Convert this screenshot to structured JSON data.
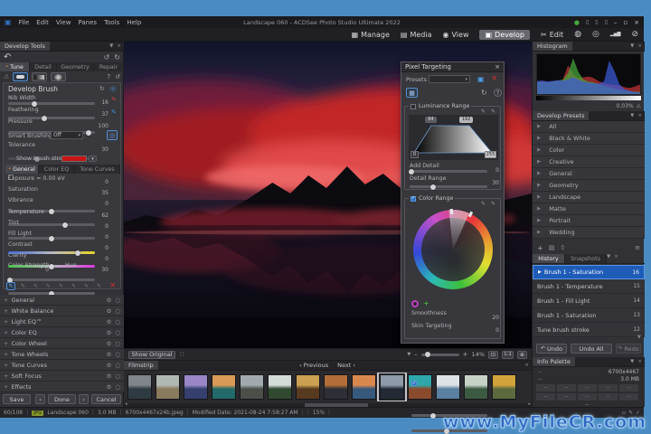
{
  "icons": {
    "app": "▣",
    "user": "●",
    "layout": "▯",
    "minimize": "–",
    "restore": "▫",
    "close": "×",
    "manage": "▦",
    "media": "▤",
    "view": "◉",
    "develop": "▣",
    "edit": "✂",
    "film": "◍",
    "c360": "◎",
    "charts": "▂▅▇",
    "privacy": "⊘",
    "pin": "▼",
    "x": "×",
    "undo": "↶",
    "redo": "↷",
    "reset": "↺",
    "refresh": "↻",
    "help": "?",
    "warn": "⚠",
    "gear": "⚙",
    "circle": "○",
    "play": "▶",
    "plus": "+",
    "menu": "≡",
    "export": "⇧",
    "grid": "▤",
    "dropper": "✎",
    "brush": "✎",
    "check": "✓",
    "target": "◎",
    "chevdown": "▾",
    "chevleft": "‹",
    "chevright": "›",
    "fit": "⊡",
    "pan": "⊕",
    "dots": "∷",
    "left": "◂",
    "right": "▸",
    "dot": "•"
  },
  "window": {
    "title": "Landscape 060 - ACDSee Photo Studio Ultimate 2022",
    "menus": [
      "File",
      "Edit",
      "View",
      "Panes",
      "Tools",
      "Help"
    ]
  },
  "modes": {
    "manage": "Manage",
    "media": "Media",
    "view": "View",
    "develop": "Develop",
    "edit": "Edit"
  },
  "left_panel": {
    "title": "Develop Tools",
    "tabs": [
      "Tune",
      "Detail",
      "Geometry",
      "Repair"
    ],
    "brush": {
      "title": "Develop Brush",
      "nib": {
        "label": "Nib Width",
        "value": "16",
        "pos": 30
      },
      "feather": {
        "label": "Feathering",
        "value": "37",
        "pos": 42
      },
      "pressure": {
        "label": "Pressure",
        "value": "100",
        "pos": 93
      },
      "smart": {
        "label": "Smart Brushing:",
        "value": "Off"
      },
      "tolerance": {
        "label": "Tolerance",
        "value": "30",
        "pos": 33
      },
      "strokes_label": "Show brush strokes",
      "tabs": [
        "General",
        "Color EQ",
        "Tone Curves"
      ],
      "sliders": [
        {
          "label": "Exposure = 0.00 eV",
          "value": "0",
          "pos": 50
        },
        {
          "label": "Saturation",
          "value": "35",
          "pos": 66
        },
        {
          "label": "Vibrance",
          "value": "0",
          "pos": 50
        },
        {
          "label": "Temperature",
          "value": "62",
          "pos": 80
        },
        {
          "label": "Tint",
          "value": "0",
          "pos": 50
        },
        {
          "label": "Fill Light",
          "value": "0",
          "pos": 2
        },
        {
          "label": "Contrast",
          "value": "0",
          "pos": 50
        },
        {
          "label": "Clarity",
          "value": "0",
          "pos": 50
        }
      ],
      "strength": {
        "label": "Color Strength",
        "value": "0",
        "pos": 8,
        "hue_label": "Hue",
        "hue_value": "30",
        "hue_pos": 50
      }
    },
    "groups": [
      "General",
      "White Balance",
      "Light EQ™",
      "Color EQ",
      "Color Wheel",
      "Tone Wheels",
      "Tone Curves",
      "Soft Focus",
      "Effects"
    ],
    "footer": {
      "save": "Save",
      "done": "Done",
      "cancel": "Cancel"
    }
  },
  "dialog": {
    "title": "Pixel Targeting",
    "presets_label": "Presets",
    "lum": {
      "label": "Luminance Range",
      "h64": "64",
      "h192": "192",
      "h0": "0",
      "h255": "255",
      "add_detail": {
        "label": "Add Detail",
        "value": "0",
        "pos": 2
      },
      "detail_range": {
        "label": "Detail Range",
        "value": "30",
        "pos": 30
      }
    },
    "color": {
      "label": "Color Range",
      "smoothness": {
        "label": "Smoothness",
        "value": "20",
        "pos": 28
      },
      "skin": {
        "label": "Skin Targeting",
        "value": "0",
        "pos": 46
      }
    }
  },
  "viewer": {
    "show_original": "Show Original",
    "zoom": "14%",
    "one_to_one": "1:1"
  },
  "filmstrip": {
    "title": "Filmstrip",
    "previous": "Previous",
    "next": "Next",
    "thumbs": [
      {
        "top": "#7f858a",
        "bottom": "#2e3b42"
      },
      {
        "top": "#b0b8b4",
        "bottom": "#8a7a5e"
      },
      {
        "top": "#9a86c6",
        "bottom": "#35406e"
      },
      {
        "top": "#d89a56",
        "bottom": "#236a6a"
      },
      {
        "top": "#a2aab0",
        "bottom": "#4a4f4a"
      },
      {
        "top": "#d4dcd8",
        "bottom": "#30492f"
      },
      {
        "top": "#caa052",
        "bottom": "#573a20"
      },
      {
        "top": "#b26e36",
        "bottom": "#2e2e36"
      },
      {
        "top": "#d8884e",
        "bottom": "#36597c"
      },
      {
        "top": "#8e9aa8",
        "bottom": "#232a36",
        "selected": true
      },
      {
        "top": "#2ea6aa",
        "bottom": "#8a4a2e"
      },
      {
        "top": "#dce2e6",
        "bottom": "#5a80a0"
      },
      {
        "top": "#c6d2c6",
        "bottom": "#3c5a42"
      },
      {
        "top": "#d0a43a",
        "bottom": "#5c6a3e"
      }
    ]
  },
  "right_panel": {
    "histogram": {
      "title": "Histogram",
      "clipping": "0.03%",
      "series": {
        "red": [
          30,
          33,
          30,
          32,
          34,
          36,
          72,
          50,
          40,
          42,
          44,
          40,
          32,
          27,
          25,
          23,
          21,
          17,
          15,
          19,
          24
        ],
        "green": [
          28,
          31,
          29,
          31,
          33,
          36,
          52,
          90,
          56,
          36,
          31,
          29,
          25,
          21,
          17,
          13,
          11,
          9,
          7,
          6,
          5
        ],
        "blue": [
          33,
          34,
          32,
          33,
          35,
          34,
          37,
          42,
          36,
          31,
          29,
          27,
          26,
          32,
          84,
          58,
          24,
          12,
          8,
          5,
          4
        ]
      }
    },
    "presets": {
      "title": "Develop Presets",
      "items": [
        "All",
        "Black & White",
        "Color",
        "Creative",
        "General",
        "Geometry",
        "Landscape",
        "Matte",
        "Portrait",
        "Wedding"
      ]
    },
    "history": {
      "tab_history": "History",
      "tab_snapshots": "Snapshots",
      "items": [
        {
          "label": "Brush 1 - Saturation",
          "step": "16"
        },
        {
          "label": "Brush 1 - Temperature",
          "step": "15"
        },
        {
          "label": "Brush 1 - Fill Light",
          "step": "14"
        },
        {
          "label": "Brush 1 - Saturation",
          "step": "13"
        },
        {
          "label": "Tune brush stroke",
          "step": "12"
        }
      ],
      "undo": "Undo",
      "undo_all": "Undo All",
      "redo": "Redo"
    },
    "info": {
      "title": "Info Palette",
      "dimensions": "6700x4467",
      "size": "3.0 MB",
      "na": "--"
    }
  },
  "statusbar": {
    "position": "60/108",
    "format": "JPG",
    "filename": "Landscape 060",
    "filesize": "3.0 MB",
    "dimensions": "6700x4467x24b.jpeg",
    "modified": "Modified Date: 2021-08-24 7:58:27 AM",
    "zoom": "15%"
  },
  "watermark": "www.MyFileCR.com"
}
